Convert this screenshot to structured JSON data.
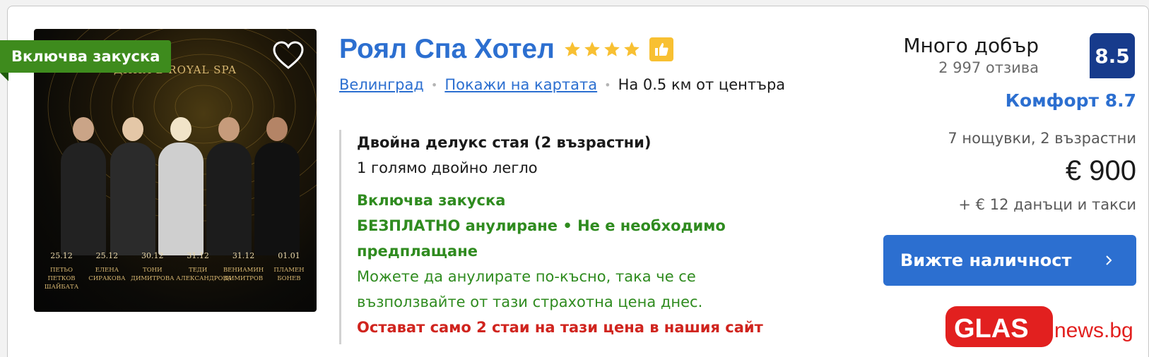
{
  "hotel": {
    "name": "Роял Спа Хотел",
    "stars": 4,
    "location_link": "Велинград",
    "map_link": "Покажи на картата",
    "distance": "На 0.5 км от центъра"
  },
  "image": {
    "ribbon": "Включва закуска",
    "headline": "ДИНА В ROYAL SPA",
    "events": [
      {
        "date": "25.12",
        "name1": "ПЕТЬО ПЕТКОВ",
        "name2": "ШАЙБАТА"
      },
      {
        "date": "25.12",
        "name1": "ЕЛЕНА",
        "name2": "СИРАКОВА"
      },
      {
        "date": "30.12",
        "name1": "ТОНИ",
        "name2": "ДИМИТРОВА"
      },
      {
        "date": "31.12",
        "name1": "ТЕДИ",
        "name2": "АЛЕКСАНДРОВА"
      },
      {
        "date": "31.12",
        "name1": "ВЕНИАМИН",
        "name2": "ДИМИТРОВ"
      },
      {
        "date": "01.01",
        "name1": "ПЛАМЕН",
        "name2": "БОНЕВ"
      }
    ]
  },
  "room": {
    "title": "Двойна делукс стая (2 възрастни)",
    "bed": "1 голямо двойно легло",
    "breakfast": "Включва закуска",
    "free_cancel_line1": "БЕЗПЛАТНО анулиране • Не е необходимо",
    "free_cancel_line2": "предплащане",
    "cancel_note_line1": "Можете да анулирате по-късно, така че се",
    "cancel_note_line2": "възползвайте от тази страхотна цена днес.",
    "scarcity": "Остават само 2 стаи на тази цена в нашия сайт"
  },
  "review": {
    "word": "Много добър",
    "count": "2 997 отзива",
    "score": "8.5",
    "comfort": "Комфорт 8.7"
  },
  "pricing": {
    "stay": "7 нощувки, 2 възрастни",
    "price": "€ 900",
    "taxes": "+ € 12 данъци и такси",
    "cta": "Вижте наличност"
  },
  "watermark": {
    "brand": "GLAS",
    "suffix": "news.bg"
  },
  "colors": {
    "link_blue": "#2c6fd0",
    "score_navy": "#173b8c",
    "green": "#2f8b1f",
    "ribbon_green": "#3e8b1d",
    "red": "#d0241e",
    "star_yellow": "#f8c032"
  },
  "icons": [
    "heart-icon",
    "star-icon",
    "thumbs-up-icon",
    "chevron-right-icon"
  ]
}
